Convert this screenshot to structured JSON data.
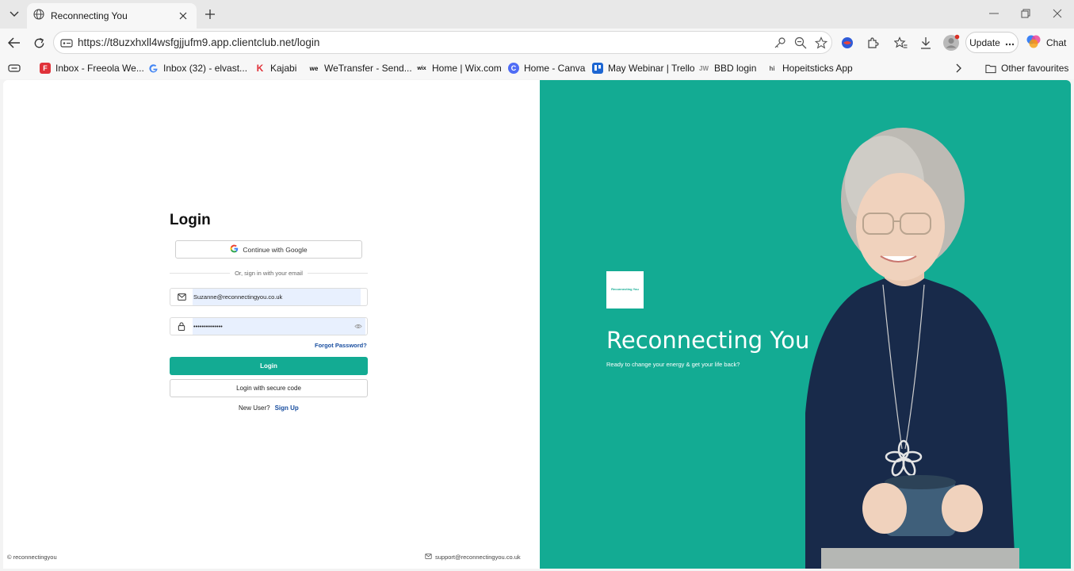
{
  "browser": {
    "tab_title": "Reconnecting You",
    "url": "https://t8uzxhxll4wsfgjjufm9.app.clientclub.net/login",
    "update_label": "Update",
    "chat_label": "Chat"
  },
  "bookmarks": [
    {
      "label": "Inbox - Freeola We...",
      "icon": "freeola-icon"
    },
    {
      "label": "Inbox (32) - elvast...",
      "icon": "google-icon"
    },
    {
      "label": "Kajabi",
      "icon": "kajabi-icon"
    },
    {
      "label": "WeTransfer - Send...",
      "icon": "wetransfer-icon"
    },
    {
      "label": "Home | Wix.com",
      "icon": "wix-icon"
    },
    {
      "label": "Home - Canva",
      "icon": "canva-icon"
    },
    {
      "label": "May Webinar | Trello",
      "icon": "trello-icon"
    },
    {
      "label": "BBD login",
      "icon": "jw-icon"
    },
    {
      "label": "Hopeitsticks App",
      "icon": "hopeitsticks-icon"
    }
  ],
  "other_favourites": "Other favourites",
  "login": {
    "title": "Login",
    "google_label": "Continue with Google",
    "divider_text": "Or, sign in with your email",
    "email_value": "Suzanne@reconnectingyou.co.uk",
    "password_value": "••••••••••••••",
    "forgot_label": "Forgot Password?",
    "login_label": "Login",
    "secure_code_label": "Login with secure code",
    "new_user_text": "New User?",
    "signup_label": "Sign Up"
  },
  "footer": {
    "copyright": "© reconnectingyou",
    "support_email": "support@reconnectingyou.co.uk"
  },
  "brand": {
    "logo_text": "Reconnecting You",
    "title": "Reconnecting You",
    "tagline": "Ready to change your energy & get your life back?",
    "accent_color": "#13ab93"
  }
}
